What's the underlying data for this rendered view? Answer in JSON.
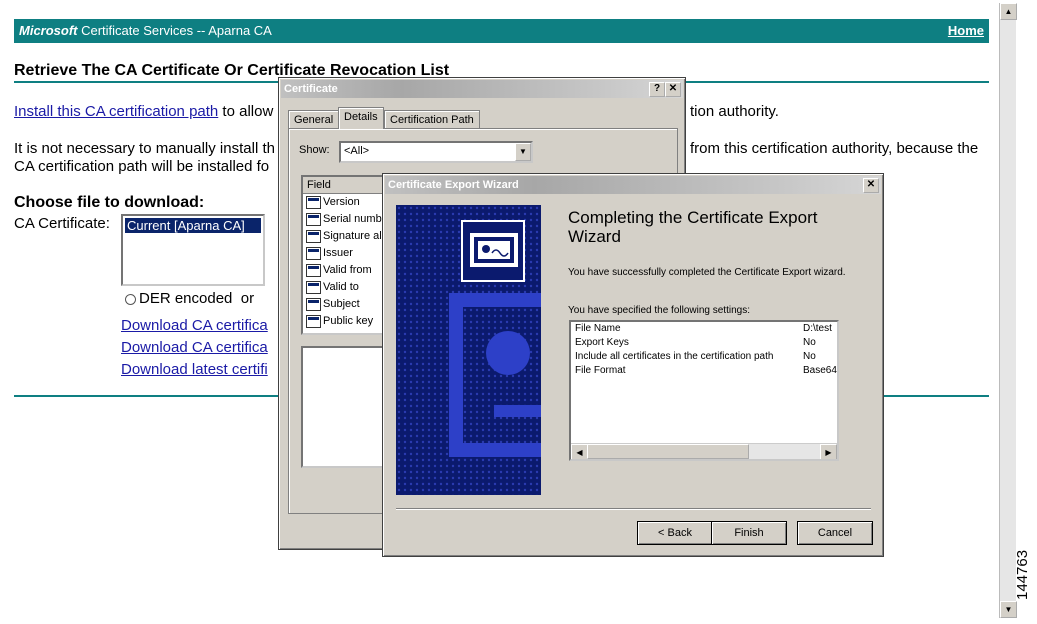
{
  "page": {
    "banner_brand": "Microsoft",
    "banner_title": " Certificate Services  --  Aparna CA",
    "home_link": "Home",
    "heading": "Retrieve The CA Certificate Or Certificate Revocation List",
    "install_link": "Install this CA certification path",
    "install_text_left": " to allow",
    "install_text_right": "tion authority.",
    "para_left_1": "It is not necessary to manually install th",
    "para_left_2": "CA certification path will be installed fo",
    "para_right_1": "from this certification authority, because the",
    "choose_label": "Choose file to download:",
    "ca_cert_label": "CA Certificate:",
    "ca_list_items": [
      "Current [Aparna CA]"
    ],
    "der_label": "DER encoded",
    "or_label": "or",
    "link1": "Download CA certifica",
    "link2": "Download CA certifica",
    "link3": "Download latest certifi"
  },
  "cert_dialog": {
    "title": "Certificate",
    "tabs": [
      "General",
      "Details",
      "Certification Path"
    ],
    "active_tab": "Details",
    "show_label": "Show:",
    "show_value": "<All>",
    "field_header": "Field",
    "fields": [
      "Version",
      "Serial numbe",
      "Signature alg",
      "Issuer",
      "Valid from",
      "Valid to",
      "Subject",
      "Public key"
    ]
  },
  "wizard": {
    "title": "Certificate Export Wizard",
    "heading": "Completing the Certificate Export Wizard",
    "text1": "You have successfully completed the Certificate Export wizard.",
    "text2": "You have specified the following settings:",
    "settings": [
      {
        "key": "File Name",
        "value": "D:\\test"
      },
      {
        "key": "Export Keys",
        "value": "No"
      },
      {
        "key": "Include all certificates in the certification path",
        "value": "No"
      },
      {
        "key": "File Format",
        "value": "Base64"
      }
    ],
    "back_button": "< Back",
    "finish_button": "Finish",
    "cancel_button": "Cancel"
  },
  "figure_number": "144763"
}
